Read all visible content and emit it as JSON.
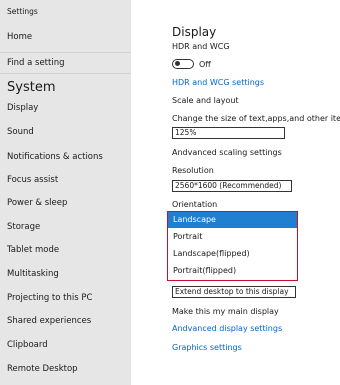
{
  "sidebar": {
    "settings_label": "Settings",
    "home": "Home",
    "find_setting": "Find a setting",
    "section_title": "System",
    "items": [
      "Display",
      "Sound",
      "Notifications & actions",
      "Focus assist",
      "Power & sleep",
      "Storage",
      "Tablet mode",
      "Multitasking",
      "Projecting to this PC",
      "Shared experiences",
      "Clipboard",
      "Remote Desktop"
    ]
  },
  "main": {
    "title": "Display",
    "hdr_label": "HDR and WCG",
    "hdr_toggle": "Off",
    "hdr_settings_link": "HDR and WCG settings",
    "scale_layout": "Scale and layout",
    "change_size": "Change the size of text,apps,and other items",
    "scale_value": "125%",
    "advanced_scaling": "Andvanced scaling settings",
    "resolution_label": "Resolution",
    "resolution_value": "2560*1600 (Recommended)",
    "orientation_label": "Orientation",
    "orientation_options": [
      "Landscape",
      "Portrait",
      "Landscape(flipped)",
      "Portrait(flipped)"
    ],
    "orientation_selected": "Landscape",
    "multiple_displays_value": "Extend desktop to this display",
    "make_main": "Make this my main display",
    "advanced_display": "Andvanced display settings",
    "graphics_settings": "Graphics settings"
  },
  "colors": {
    "sidebar_bg": "#e6e6e6",
    "link": "#0066cc",
    "dropdown_border": "#c8102e",
    "selected_bg": "#1f7fd1"
  }
}
